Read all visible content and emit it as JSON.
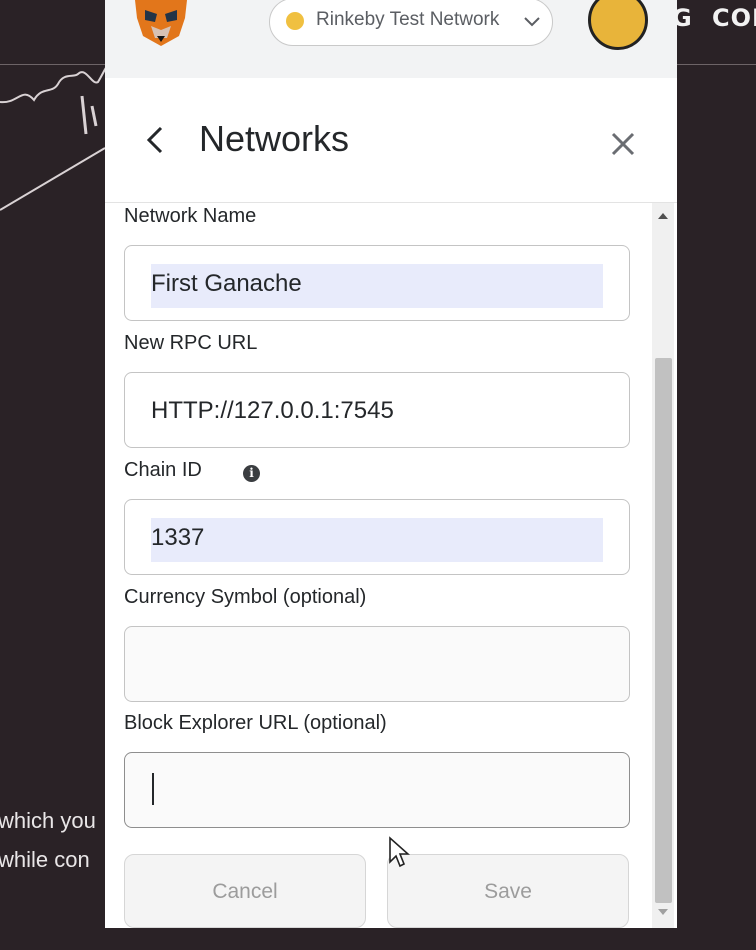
{
  "background": {
    "nav": [
      "G",
      "COM"
    ],
    "text_lines": [
      "which you",
      "while con"
    ]
  },
  "popup": {
    "network": {
      "label": "Rinkeby Test Network",
      "dot_color": "#f0c040"
    },
    "avatar_color": "#e8b43a",
    "header": {
      "title": "Networks",
      "back_icon": "chevron-left-icon",
      "close_icon": "close-icon"
    },
    "form": {
      "network_name": {
        "label": "Network Name",
        "value": "First Ganache"
      },
      "rpc_url": {
        "label": "New RPC URL",
        "value": "HTTP://127.0.0.1:7545"
      },
      "chain_id": {
        "label": "Chain ID",
        "value": "1337"
      },
      "currency_symbol": {
        "label": "Currency Symbol (optional)",
        "value": ""
      },
      "block_explorer": {
        "label": "Block Explorer URL (optional)",
        "value": ""
      }
    },
    "buttons": {
      "cancel": "Cancel",
      "save": "Save"
    }
  }
}
